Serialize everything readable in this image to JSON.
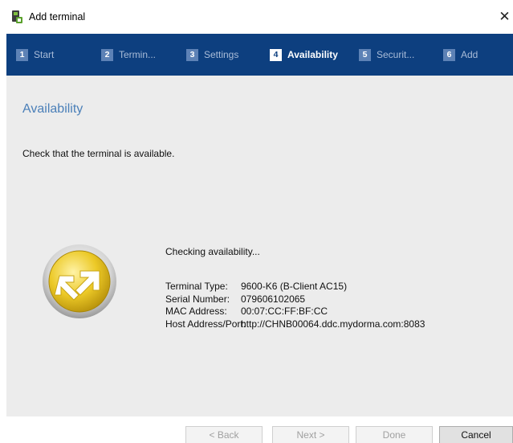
{
  "window": {
    "title": "Add terminal",
    "close_glyph": "✕"
  },
  "steps": [
    {
      "num": "1",
      "label": "Start",
      "active": false
    },
    {
      "num": "2",
      "label": "Termin...",
      "active": false
    },
    {
      "num": "3",
      "label": "Settings",
      "active": false
    },
    {
      "num": "4",
      "label": "Availability",
      "active": true
    },
    {
      "num": "5",
      "label": "Securit...",
      "active": false
    },
    {
      "num": "6",
      "label": "Add",
      "active": false
    }
  ],
  "page": {
    "title": "Availability",
    "instruction": "Check that the terminal is available.",
    "status": "Checking availability..."
  },
  "terminal": {
    "type_label": "Terminal Type:",
    "type_value": "9600-K6 (B-Client AC15)",
    "serial_label": "Serial Number:",
    "serial_value": "079606102065",
    "mac_label": "MAC Address:",
    "mac_value": "00:07:CC:FF:BF:CC",
    "host_label": "Host Address/Port:",
    "host_value": "http://CHNB00064.ddc.mydorma.com:8083"
  },
  "buttons": {
    "back": "< Back",
    "next": "Next >",
    "done": "Done",
    "cancel": "Cancel"
  },
  "colors": {
    "step_bar": "#0d3f7f",
    "title_accent": "#4a7fb8",
    "content_bg": "#ececec",
    "badge_gold": "#e8c21a"
  },
  "icons": {
    "app": "terminal-app-icon",
    "status": "sync-arrows-icon"
  }
}
